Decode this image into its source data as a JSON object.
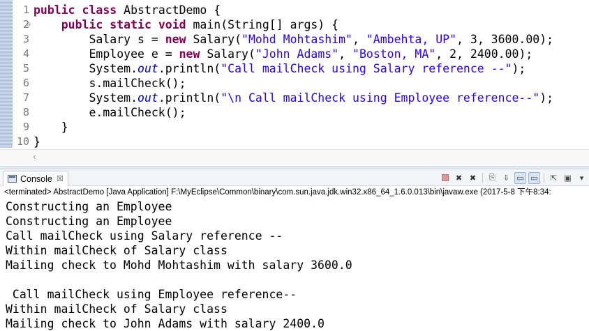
{
  "editor": {
    "lines": [
      {
        "num": "1",
        "marker": "",
        "segments": [
          {
            "t": "public class",
            "c": "kw"
          },
          {
            "t": " AbstractDemo {",
            "c": ""
          }
        ]
      },
      {
        "num": "2",
        "marker": "⊖",
        "segments": [
          {
            "t": "    ",
            "c": ""
          },
          {
            "t": "public static void",
            "c": "kw"
          },
          {
            "t": " main(String[] args) {",
            "c": ""
          }
        ]
      },
      {
        "num": "3",
        "marker": "",
        "segments": [
          {
            "t": "        Salary s = ",
            "c": ""
          },
          {
            "t": "new",
            "c": "kw"
          },
          {
            "t": " Salary(",
            "c": ""
          },
          {
            "t": "\"Mohd Mohtashim\"",
            "c": "str"
          },
          {
            "t": ", ",
            "c": ""
          },
          {
            "t": "\"Ambehta, UP\"",
            "c": "str"
          },
          {
            "t": ", 3, 3600.00);",
            "c": ""
          }
        ]
      },
      {
        "num": "4",
        "marker": "",
        "segments": [
          {
            "t": "        Employee e = ",
            "c": ""
          },
          {
            "t": "new",
            "c": "kw"
          },
          {
            "t": " Salary(",
            "c": ""
          },
          {
            "t": "\"John Adams\"",
            "c": "str"
          },
          {
            "t": ", ",
            "c": ""
          },
          {
            "t": "\"Boston, MA\"",
            "c": "str"
          },
          {
            "t": ", 2, 2400.00);",
            "c": ""
          }
        ]
      },
      {
        "num": "5",
        "marker": "",
        "segments": [
          {
            "t": "        System.",
            "c": ""
          },
          {
            "t": "out",
            "c": "fld"
          },
          {
            "t": ".println(",
            "c": ""
          },
          {
            "t": "\"Call mailCheck using Salary reference --\"",
            "c": "str"
          },
          {
            "t": ");",
            "c": ""
          }
        ]
      },
      {
        "num": "6",
        "marker": "",
        "segments": [
          {
            "t": "        s.mailCheck();",
            "c": ""
          }
        ]
      },
      {
        "num": "7",
        "marker": "",
        "segments": [
          {
            "t": "        System.",
            "c": ""
          },
          {
            "t": "out",
            "c": "fld"
          },
          {
            "t": ".println(",
            "c": ""
          },
          {
            "t": "\"\\n Call mailCheck using Employee reference--\"",
            "c": "str"
          },
          {
            "t": ");",
            "c": ""
          }
        ]
      },
      {
        "num": "8",
        "marker": "",
        "segments": [
          {
            "t": "        e.mailCheck();",
            "c": ""
          }
        ]
      },
      {
        "num": "9",
        "marker": "",
        "segments": [
          {
            "t": "    }",
            "c": ""
          }
        ]
      },
      {
        "num": "10",
        "marker": "",
        "segments": [
          {
            "t": "}",
            "c": ""
          }
        ]
      }
    ],
    "scroll_left_arrow": "‹"
  },
  "console": {
    "tab_label": "Console",
    "tab_close": "☒",
    "toolbar": [
      {
        "icon": "terminate-icon",
        "glyph": ""
      },
      {
        "icon": "remove-launch-icon",
        "glyph": "✖"
      },
      {
        "icon": "remove-all-terminated-icon",
        "glyph": "✖"
      },
      {
        "icon": "clear-console-icon",
        "glyph": "⎘"
      },
      {
        "icon": "scroll-lock-icon",
        "glyph": "⇩"
      },
      {
        "icon": "show-stdout-icon",
        "glyph": "▭"
      },
      {
        "icon": "show-stderr-icon",
        "glyph": "▭"
      },
      {
        "icon": "pin-console-icon",
        "glyph": "⇱"
      },
      {
        "icon": "display-console-icon",
        "glyph": "▣"
      },
      {
        "icon": "dropdown-icon",
        "glyph": "▾"
      }
    ],
    "terminated_text": "<terminated> AbstractDemo [Java Application] F:\\MyEclipse\\Common\\binary\\com.sun.java.jdk.win32.x86_64_1.6.0.013\\bin\\javaw.exe (2017-5-8 下午8:34:",
    "output": [
      "Constructing an Employee",
      "Constructing an Employee",
      "Call mailCheck using Salary reference --",
      "Within mailCheck of Salary class",
      "Mailing check to Mohd Mohtashim with salary 3600.0",
      "",
      " Call mailCheck using Employee reference--",
      "Within mailCheck of Salary class",
      "Mailing check to John Adams with salary 2400.0"
    ]
  }
}
